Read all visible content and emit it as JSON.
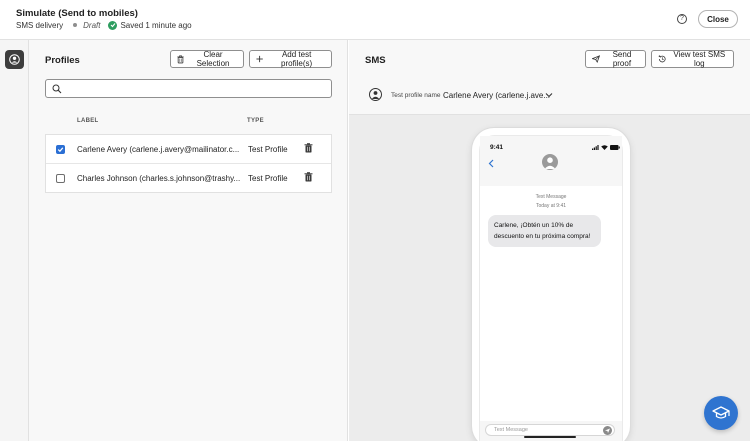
{
  "header": {
    "title": "Simulate (Send to mobiles)",
    "subtitle": "SMS delivery",
    "status": "Draft",
    "saved": "Saved 1 minute ago",
    "help_icon": "help-icon",
    "close_label": "Close"
  },
  "rail": {
    "icon": "profile-icon"
  },
  "profiles": {
    "title": "Profiles",
    "clear_label": "Clear Selection",
    "add_label": "Add test profile(s)",
    "search_placeholder": "",
    "columns": {
      "label": "LABEL",
      "type": "TYPE"
    },
    "rows": [
      {
        "label": "Carlene Avery (carlene.j.avery@mailinator.c...",
        "type": "Test Profile",
        "checked": true
      },
      {
        "label": "Charles Johnson (charles.s.johnson@trashy...",
        "type": "Test Profile",
        "checked": false
      }
    ]
  },
  "sms": {
    "title": "SMS",
    "send_proof_label": "Send proof",
    "view_log_label": "View test SMS log",
    "test_profile_label": "Test profile name",
    "test_profile_value": "Carlene Avery (carlene.j.ave..."
  },
  "phone": {
    "time": "9:41",
    "message_header": "Text Message",
    "message_time": "Today at 9:41",
    "message_text": "Carlene, ¡Obtén un 10% de descuento en tu próxima compra!",
    "compose_placeholder": "Text Message"
  },
  "colors": {
    "accent": "#2f74d0",
    "saved_check": "#2d9d5f",
    "checkbox": "#2b6fd4"
  }
}
